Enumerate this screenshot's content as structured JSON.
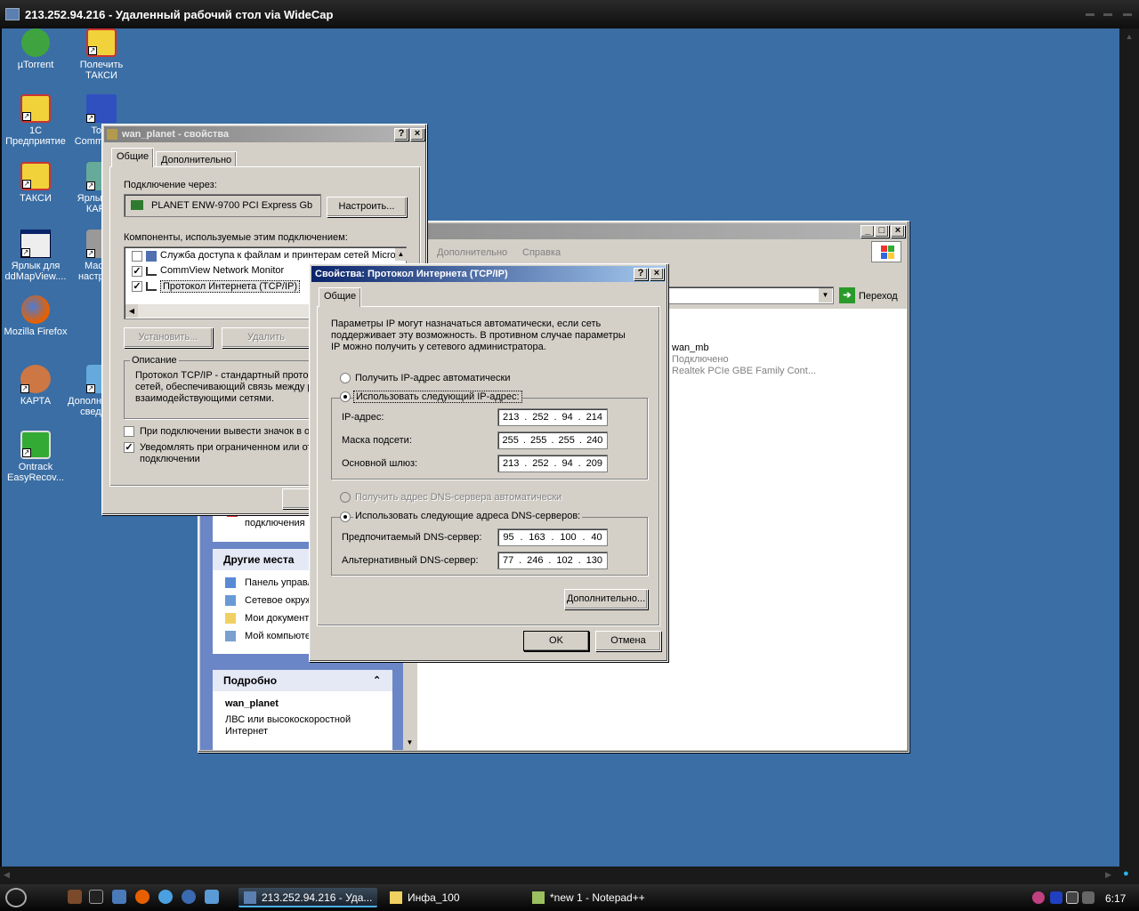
{
  "rdp": {
    "title": "213.252.94.216 - Удаленный рабочий стол via WideCap"
  },
  "desktop_icons": [
    {
      "label": "µTorrent",
      "icon": "utorrent-icon",
      "color": "#3fa33f"
    },
    {
      "label": "Полечить ТАКСИ",
      "icon": "taxi-icon",
      "color": "#c33"
    },
    {
      "label": "1С Предприятие",
      "icon": "1c-icon",
      "color": "#f2d23a"
    },
    {
      "label": "Total Commander",
      "icon": "floppy-icon",
      "color": "#3050c0"
    },
    {
      "label": "ТАКСИ",
      "icon": "taxi-icon",
      "color": "#f2d23a"
    },
    {
      "label": "Ярлык для КАРТА",
      "icon": "map-icon",
      "color": "#6a9"
    },
    {
      "label": "Ярлык для ddMapView....",
      "icon": "window-icon",
      "color": "#eee"
    },
    {
      "label": "Мастер настройки",
      "icon": "wizard-icon",
      "color": "#999"
    },
    {
      "label": "Mozilla Firefox",
      "icon": "firefox-icon",
      "color": "#e66000"
    },
    {
      "label": "КАРТА",
      "icon": "map-icon",
      "color": "#c74"
    },
    {
      "label": "Дополнительные сведения",
      "icon": "info-icon",
      "color": "#6ad"
    },
    {
      "label": "Ontrack EasyRecov...",
      "icon": "ontrack-icon",
      "color": "#3a3"
    }
  ],
  "netconn": {
    "menu": [
      "Дополнительно",
      "Справка"
    ],
    "go_label": "Переход",
    "conn_name": "wan_mb",
    "conn_status": "Подключено",
    "conn_device": "Realtek PCIe GBE Family Cont...",
    "left_fragment_1": "Изменение нас",
    "left_fragment_2": "подключения",
    "other_places_title": "Другие места",
    "other_places": [
      "Панель управл",
      "Сетевое окруж",
      "Мои документ",
      "Мой компьюте"
    ],
    "details_title": "Подробно",
    "details_name": "wan_planet",
    "details_desc_1": "ЛВС или высокоскоростной",
    "details_desc_2": "Интернет"
  },
  "props": {
    "title": "wan_planet - свойства",
    "tab_general": "Общие",
    "tab_advanced": "Дополнительно",
    "connect_using": "Подключение через:",
    "adapter": "PLANET ENW-9700 PCI Express Gb",
    "configure": "Настроить...",
    "components_label": "Компоненты, используемые этим подключением:",
    "components": [
      {
        "label": "Служба доступа к файлам и принтерам сетей Micro",
        "checked": false
      },
      {
        "label": "CommView Network Monitor",
        "checked": true
      },
      {
        "label": "Протокол Интернета (TCP/IP)",
        "checked": true
      }
    ],
    "install": "Установить...",
    "uninstall": "Удалить",
    "description_title": "Описание",
    "description_1": "Протокол TCP/IP - стандартный протоко",
    "description_2": "сетей, обеспечивающий связь между р",
    "description_3": "взаимодействующими сетями.",
    "show_icon": "При подключении вывести значок в о",
    "notify_1": "Уведомлять при ограниченном или от",
    "notify_2": "подключении",
    "ok_fragment": "("
  },
  "tcpip": {
    "title": "Свойства: Протокол Интернета (TCP/IP)",
    "tab": "Общие",
    "info_1": "Параметры IP могут назначаться автоматически, если сеть",
    "info_2": "поддерживает эту возможность. В противном случае параметры",
    "info_3": "IP можно получить у сетевого администратора.",
    "auto_ip": "Получить IP-адрес автоматически",
    "manual_ip": "Использовать следующий IP-адрес:",
    "ip_label": "IP-адрес:",
    "ip": [
      "213",
      "252",
      "94",
      "214"
    ],
    "mask_label": "Маска подсети:",
    "mask": [
      "255",
      "255",
      "255",
      "240"
    ],
    "gw_label": "Основной шлюз:",
    "gw": [
      "213",
      "252",
      "94",
      "209"
    ],
    "auto_dns": "Получить адрес DNS-сервера автоматически",
    "manual_dns": "Использовать следующие адреса DNS-серверов:",
    "dns1_label": "Предпочитаемый DNS-сервер:",
    "dns1": [
      "95",
      "163",
      "100",
      "40"
    ],
    "dns2_label": "Альтернативный DNS-сервер:",
    "dns2": [
      "77",
      "246",
      "102",
      "130"
    ],
    "advanced": "Дополнительно...",
    "ok": "OK",
    "cancel": "Отмена"
  },
  "taskbar": {
    "items": [
      "213.252.94.216 - Уда...",
      "Инфа_100",
      "*new 1 - Notepad++"
    ],
    "clock": "6:17"
  }
}
